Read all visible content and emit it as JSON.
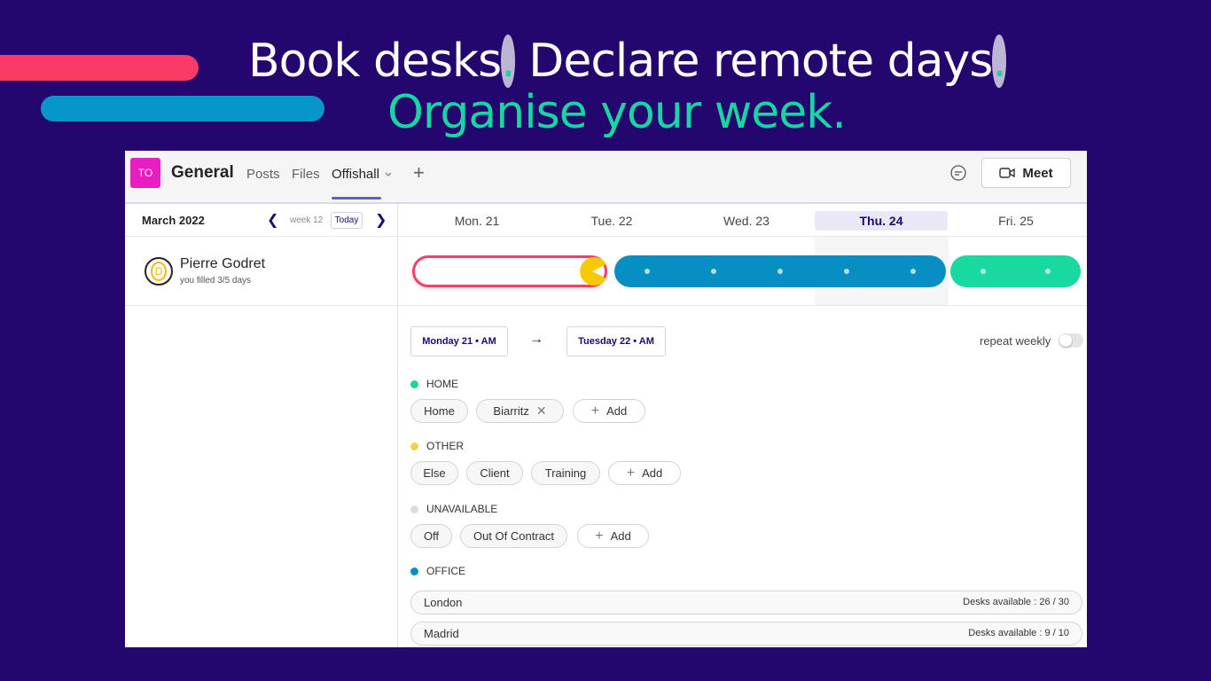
{
  "hero": {
    "line1_part1": "Book desks",
    "line1_dot1": ".",
    "line1_part2": " Declare remote days",
    "line1_dot2": ".",
    "line2": "Organise your week."
  },
  "topbar": {
    "team_initials": "TO",
    "channel": "General",
    "tabs": [
      "Posts",
      "Files",
      "Offishall"
    ],
    "meet_label": "Meet"
  },
  "calendar": {
    "month": "March 2022",
    "week": "week 12",
    "today_label": "Today",
    "days": [
      "Mon. 21",
      "Tue. 22",
      "Wed. 23",
      "Thu. 24",
      "Fri. 25"
    ],
    "current_day": "Thu. 24"
  },
  "user": {
    "initial": "D",
    "name": "Pierre Godret",
    "status": "you filled 3/5 days"
  },
  "booking": {
    "from": "Monday 21 • AM",
    "to": "Tuesday 22 • AM",
    "repeat_label": "repeat weekly"
  },
  "sections": {
    "home": {
      "title": "HOME",
      "color": "#19d5a2",
      "chips": [
        "Home",
        "Biarritz"
      ],
      "add": "Add"
    },
    "other": {
      "title": "OTHER",
      "color": "#f7cf4f",
      "chips": [
        "Else",
        "Client",
        "Training"
      ],
      "add": "Add"
    },
    "unavailable": {
      "title": "UNAVAILABLE",
      "color": "#dcdcdc",
      "chips": [
        "Off",
        "Out Of Contract"
      ],
      "add": "Add"
    },
    "office": {
      "title": "OFFICE",
      "color": "#078ec2",
      "rows": [
        {
          "name": "London",
          "availability": "Desks available : 26 / 30"
        },
        {
          "name": "Madrid",
          "availability": "Desks available : 9 / 10"
        }
      ]
    }
  }
}
